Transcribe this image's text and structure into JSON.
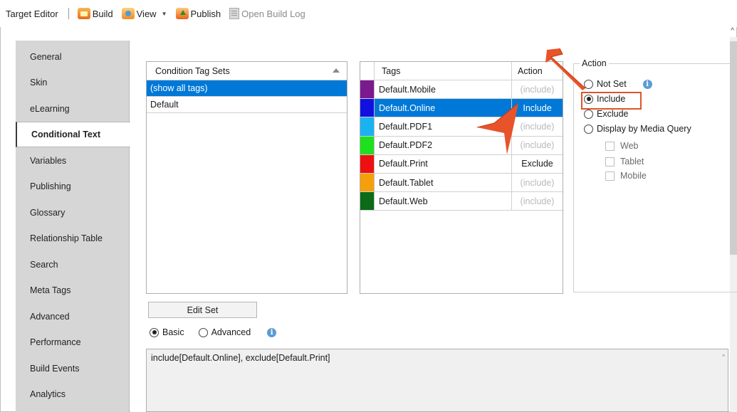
{
  "toolbar": {
    "title": "Target Editor",
    "build": "Build",
    "view": "View",
    "publish": "Publish",
    "open_build_log": "Open Build Log"
  },
  "tabs": [
    {
      "label": "General"
    },
    {
      "label": "Skin"
    },
    {
      "label": "eLearning"
    },
    {
      "label": "Conditional Text",
      "active": true
    },
    {
      "label": "Variables"
    },
    {
      "label": "Publishing"
    },
    {
      "label": "Glossary"
    },
    {
      "label": "Relationship Table"
    },
    {
      "label": "Search"
    },
    {
      "label": "Meta Tags"
    },
    {
      "label": "Advanced"
    },
    {
      "label": "Performance"
    },
    {
      "label": "Build Events"
    },
    {
      "label": "Analytics"
    }
  ],
  "condition_sets": {
    "header": "Condition Tag Sets",
    "rows": [
      "(show all tags)",
      "Default"
    ],
    "selected_index": 0
  },
  "tags_table": {
    "col_tags": "Tags",
    "col_action": "Action",
    "rows": [
      {
        "color": "#7a1a8c",
        "name": "Default.Mobile",
        "action": "(include)",
        "set": false
      },
      {
        "color": "#1010e0",
        "name": "Default.Online",
        "action": "Include",
        "set": true,
        "selected": true
      },
      {
        "color": "#1ab2f0",
        "name": "Default.PDF1",
        "action": "(include)",
        "set": false
      },
      {
        "color": "#1ee01e",
        "name": "Default.PDF2",
        "action": "(include)",
        "set": false
      },
      {
        "color": "#ee1010",
        "name": "Default.Print",
        "action": "Exclude",
        "set": true
      },
      {
        "color": "#f5a00a",
        "name": "Default.Tablet",
        "action": "(include)",
        "set": false
      },
      {
        "color": "#0b6b18",
        "name": "Default.Web",
        "action": "(include)",
        "set": false
      }
    ]
  },
  "action_panel": {
    "legend": "Action",
    "options": {
      "not_set": "Not Set",
      "include": "Include",
      "exclude": "Exclude",
      "media_query": "Display by Media Query"
    },
    "selected": "include",
    "media": [
      "Web",
      "Tablet",
      "Mobile"
    ]
  },
  "edit_set_label": "Edit Set",
  "mode": {
    "basic": "Basic",
    "advanced": "Advanced",
    "selected": "basic"
  },
  "expression": "include[Default.Online], exclude[Default.Print]",
  "icons": {
    "build": "build-icon",
    "view": "view-icon",
    "publish": "publish-icon",
    "log": "log-icon",
    "info": "info-icon",
    "arrow": "callout-arrow-icon"
  },
  "accent_colors": {
    "selection": "#0078d7",
    "callout": "#e8532a"
  }
}
